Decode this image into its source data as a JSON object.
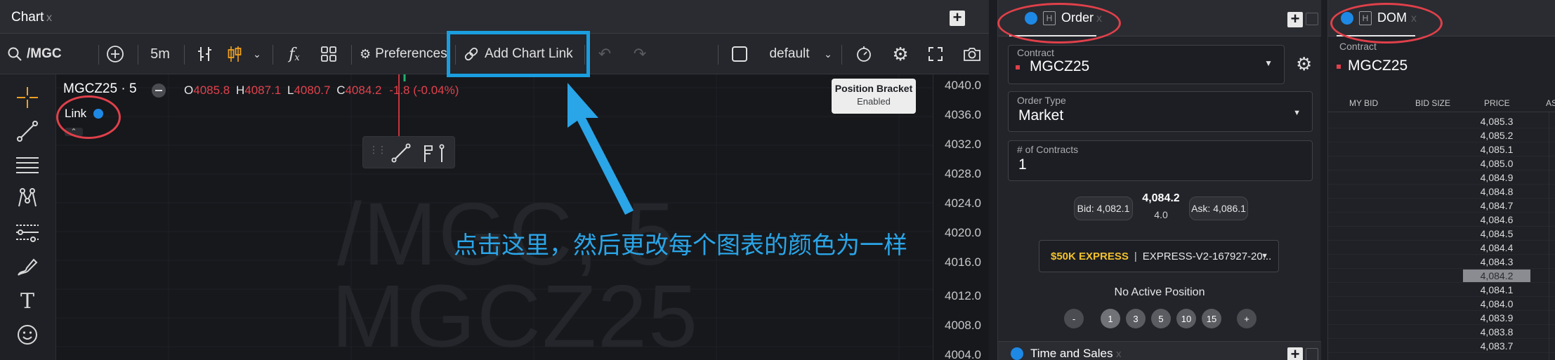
{
  "chart": {
    "tab_title": "Chart",
    "tab_close": "x",
    "symbol_search": "/MGC",
    "interval": "5m",
    "preferences_label": "Preferences",
    "add_chart_link_label": "Add Chart Link",
    "layout_name": "default",
    "legend_symbol": "MGCZ25 · 5",
    "ohlc": {
      "o_label": "O",
      "o_value": "4085.8",
      "h_label": "H",
      "h_value": "4087.1",
      "l_label": "L",
      "l_value": "4080.7",
      "c_label": "C",
      "c_value": "4084.2",
      "change": "-1.8 (-0.04%)"
    },
    "link_label": "Link",
    "position_bracket_title": "Position Bracket",
    "position_bracket_status": "Enabled",
    "watermark_line1": "/MGC, 5",
    "watermark_line2": "MGCZ25",
    "price_axis": [
      "4040.0",
      "4036.0",
      "4032.0",
      "4028.0",
      "4024.0",
      "4020.0",
      "4016.0",
      "4012.0",
      "4008.0",
      "4004.0"
    ]
  },
  "annotation": {
    "text": "点击这里，然后更改每个图表的颜色为一样",
    "color": "#2aa5e8"
  },
  "order": {
    "tab_title": "Order",
    "tab_h": "H",
    "tab_close": "x",
    "contract_label": "Contract",
    "contract_value": "MGCZ25",
    "order_type_label": "Order Type",
    "order_type_value": "Market",
    "contracts_label": "# of Contracts",
    "contracts_value": "1",
    "bid": "Bid: 4,082.1",
    "last_price": "4,084.2",
    "last_size": "4.0",
    "ask": "Ask: 4,086.1",
    "account_tag": "$50K EXPRESS",
    "account_sep": "|",
    "account_id": "EXPRESS-V2-167927-20...",
    "position_status": "No Active Position",
    "qty_minus": "-",
    "qty_presets": [
      "1",
      "3",
      "5",
      "10",
      "15"
    ],
    "qty_plus": "+",
    "time_sales_title": "Time and Sales",
    "time_sales_close": "x"
  },
  "dom": {
    "tab_title": "DOM",
    "tab_h": "H",
    "tab_close": "x",
    "contract_label": "Contract",
    "contract_value": "MGCZ25",
    "columns": [
      "MY BID",
      "BID SIZE",
      "PRICE",
      "AS"
    ],
    "prices": [
      "4,085.3",
      "4,085.2",
      "4,085.1",
      "4,085.0",
      "4,084.9",
      "4,084.8",
      "4,084.7",
      "4,084.6",
      "4,084.5",
      "4,084.4",
      "4,084.3",
      "4,084.2",
      "4,084.1",
      "4,084.0",
      "4,083.9",
      "4,083.8",
      "4,083.7"
    ],
    "highlight_price": "4,084.2"
  },
  "colors": {
    "accent_blue": "#1e88e5",
    "annotation_box": "#1a9ee0",
    "annotation_ellipse": "#e0404a",
    "ohlc_value": "#e0424c",
    "express_gold": "#f2c12e"
  }
}
